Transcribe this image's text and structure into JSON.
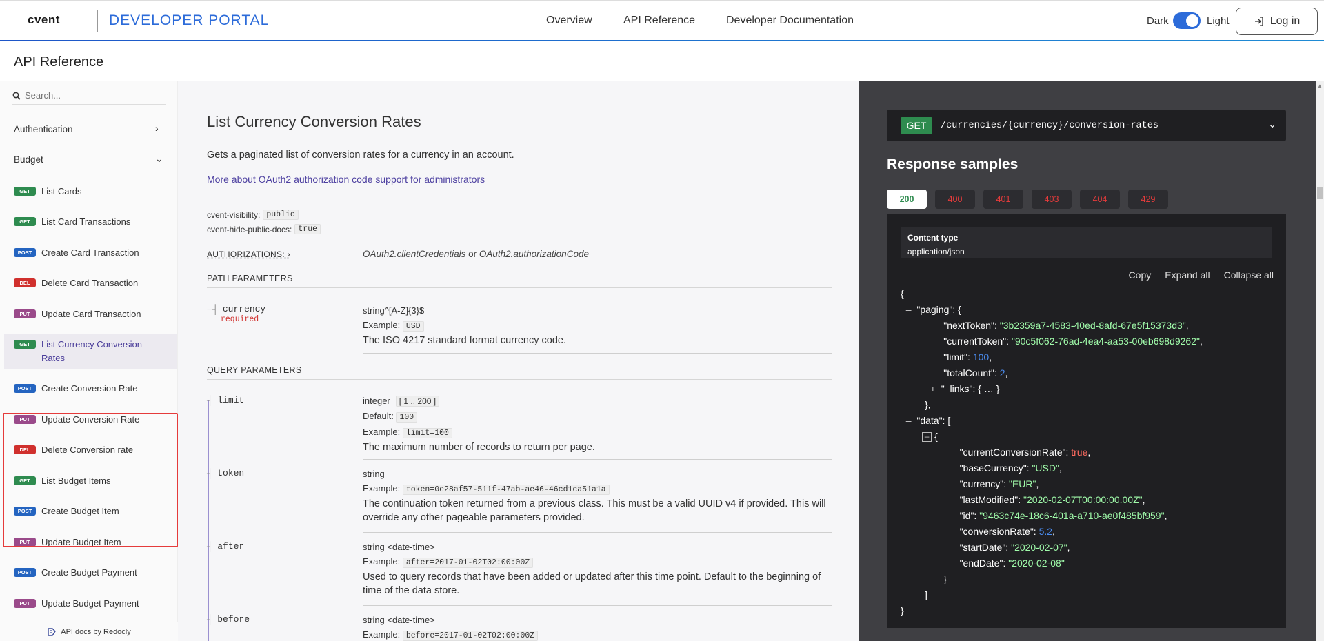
{
  "nav": {
    "logo": "cvent",
    "portal": "DEVELOPER PORTAL",
    "links": [
      "Overview",
      "API Reference",
      "Developer Documentation"
    ],
    "theme_dark": "Dark",
    "theme_light": "Light",
    "login": "Log in"
  },
  "header": {
    "title": "API Reference"
  },
  "sidebar": {
    "search_placeholder": "Search...",
    "groups": [
      "Authentication",
      "Budget"
    ],
    "items": [
      {
        "method": "GET",
        "label": "List Cards"
      },
      {
        "method": "GET",
        "label": "List Card Transactions"
      },
      {
        "method": "POST",
        "label": "Create Card Transaction"
      },
      {
        "method": "DEL",
        "label": "Delete Card Transaction"
      },
      {
        "method": "PUT",
        "label": "Update Card Transaction"
      },
      {
        "method": "GET",
        "label": "List Currency Conversion Rates"
      },
      {
        "method": "POST",
        "label": "Create Conversion Rate"
      },
      {
        "method": "PUT",
        "label": "Update Conversion Rate"
      },
      {
        "method": "DEL",
        "label": "Delete Conversion rate"
      },
      {
        "method": "GET",
        "label": "List Budget Items"
      },
      {
        "method": "POST",
        "label": "Create Budget Item"
      },
      {
        "method": "PUT",
        "label": "Update Budget Item"
      },
      {
        "method": "POST",
        "label": "Create Budget Payment"
      },
      {
        "method": "PUT",
        "label": "Update Budget Payment"
      }
    ],
    "footer": "API docs by Redocly"
  },
  "operation": {
    "title": "List Currency Conversion Rates",
    "description": "Gets a paginated list of conversion rates for a currency in an account.",
    "link": "More about OAuth2 authorization code support for administrators",
    "ext1_label": "cvent-visibility:",
    "ext1_value": "public",
    "ext2_label": "cvent-hide-public-docs:",
    "ext2_value": "true",
    "auth_label": "AUTHORIZATIONS:",
    "auth_value_a": "OAuth2.clientCredentials",
    "auth_or": " or ",
    "auth_value_b": "OAuth2.authorizationCode",
    "path_header": "PATH PARAMETERS",
    "query_header": "QUERY PARAMETERS",
    "path_params": [
      {
        "name": "currency",
        "required": "required",
        "type": "string^[A-Z]{3}$",
        "example_label": "Example:",
        "example": "USD",
        "desc": "The ISO 4217 standard format currency code."
      }
    ],
    "query_params": [
      {
        "name": "limit",
        "type": "integer",
        "range": "[ 1 .. 200 ]",
        "default_label": "Default:",
        "default": "100",
        "example_label": "Example:",
        "example": "limit=100",
        "desc": "The maximum number of records to return per page."
      },
      {
        "name": "token",
        "type": "string",
        "example_label": "Example:",
        "example": "token=0e28af57-511f-47ab-ae46-46cd1ca51a1a",
        "desc": "The continuation token returned from a previous class. This must be a valid UUID v4 if provided. This will override any other pageable parameters provided."
      },
      {
        "name": "after",
        "type": "string <date-time>",
        "example_label": "Example:",
        "example": "after=2017-01-02T02:00:00Z",
        "desc": "Used to query records that have been added or updated after this time point. Default to the beginning of time of the data store."
      },
      {
        "name": "before",
        "type": "string <date-time>",
        "example_label": "Example:",
        "example": "before=2017-01-02T02:00:00Z"
      }
    ]
  },
  "response": {
    "method": "GET",
    "path": "/currencies/{currency}/conversion-rates",
    "title": "Response samples",
    "tabs": [
      "200",
      "400",
      "401",
      "403",
      "404",
      "429"
    ],
    "content_type_label": "Content type",
    "content_type": "application/json",
    "actions": [
      "Copy",
      "Expand all",
      "Collapse all"
    ],
    "json": {
      "nextToken": "\"3b2359a7-4583-40ed-8afd-67e5f15373d3\"",
      "currentToken": "\"90c5f062-76ad-4ea4-aa53-00eb698d9262\"",
      "limit": "100",
      "totalCount": "2",
      "links_collapsed": "{ … }",
      "currentConversionRate": "true",
      "baseCurrency": "\"USD\"",
      "currency": "\"EUR\"",
      "lastModified": "\"2020-02-07T00:00:00.00Z\"",
      "id": "\"9463c74e-18c6-401a-a710-ae0f485bf959\"",
      "conversionRate": "5.2",
      "startDate": "\"2020-02-07\"",
      "endDate": "\"2020-02-08\""
    }
  },
  "colors": {
    "accent": "#2c6bd9",
    "get": "#2e8b4f",
    "post": "#2464c0",
    "del": "#d0302d",
    "put": "#9a4a8a",
    "highlight_box": "#e53b3b"
  }
}
